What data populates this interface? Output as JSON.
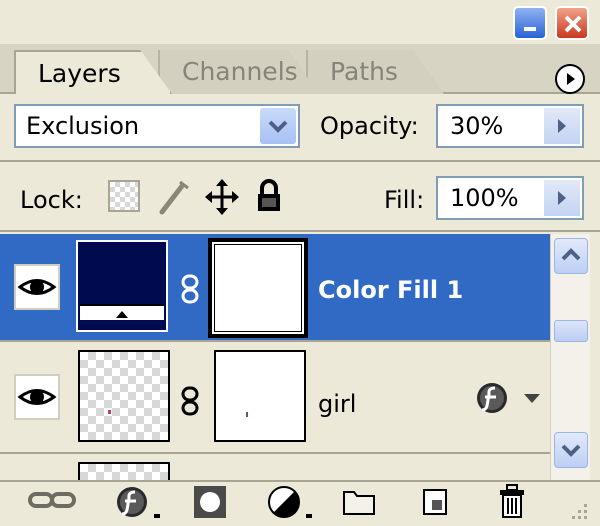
{
  "window": {
    "minimize_icon": "minimize-icon",
    "close_icon": "close-icon"
  },
  "tabs": [
    {
      "label": "Layers",
      "active": true
    },
    {
      "label": "Channels",
      "active": false
    },
    {
      "label": "Paths",
      "active": false
    }
  ],
  "blend": {
    "mode": "Exclusion",
    "opacity_label": "Opacity:",
    "opacity_value": "30%"
  },
  "lock": {
    "label": "Lock:",
    "icons": [
      "lock-transparent-pixels-icon",
      "lock-image-pixels-icon",
      "lock-position-icon",
      "lock-all-icon"
    ],
    "fill_label": "Fill:",
    "fill_value": "100%"
  },
  "layers": [
    {
      "name": "Color Fill 1",
      "selected": true,
      "visible": true,
      "color": "#000A4E"
    },
    {
      "name": "girl",
      "selected": false,
      "visible": true,
      "has_effects": true
    }
  ],
  "colors": {
    "selected_row": "#316AC5",
    "panel": "#ECE9D8",
    "fill_layer_color": "#000A4E"
  },
  "bottom_icons": [
    "link-layers-icon",
    "layer-style-icon",
    "layer-mask-icon",
    "adjustment-layer-icon",
    "new-group-icon",
    "new-layer-icon",
    "delete-layer-icon"
  ]
}
